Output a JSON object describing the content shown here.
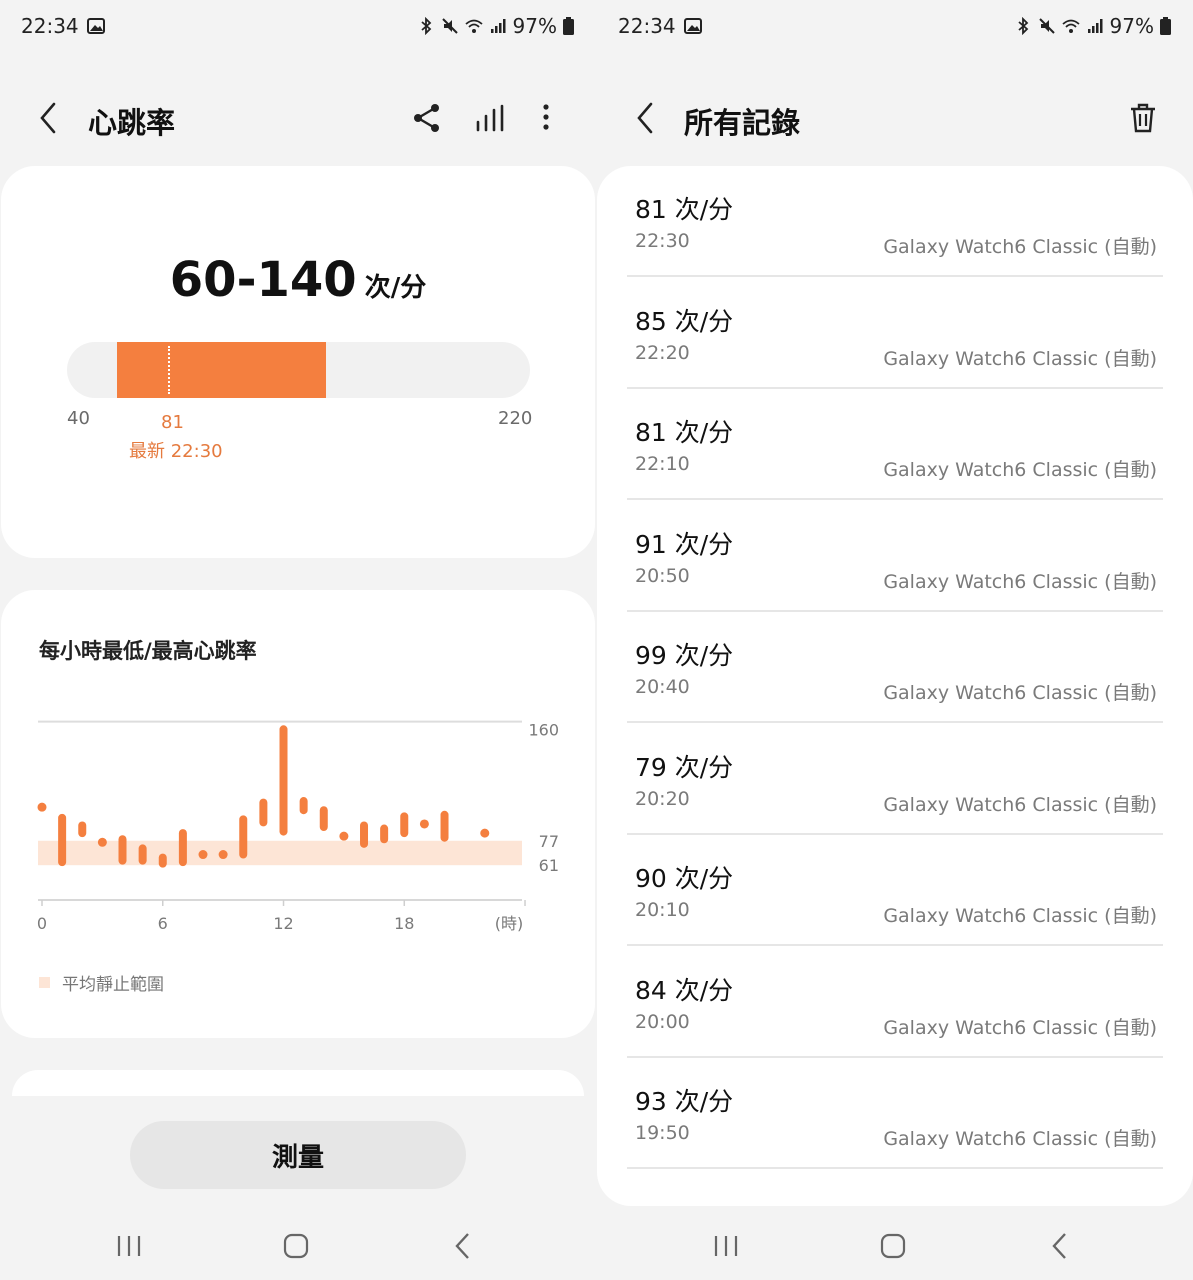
{
  "status": {
    "time": "22:34",
    "battery": "97%"
  },
  "left": {
    "header": {
      "title": "心跳率"
    },
    "range": {
      "value": "60-140",
      "unit": "次/分",
      "min_label": "40",
      "max_label": "220",
      "scale_min": 40,
      "scale_max": 220,
      "range_low": 60,
      "range_high": 140,
      "latest_value": 81,
      "latest_value_label": "81",
      "latest_text": "最新 22:30"
    },
    "chart": {
      "title": "每小時最低/最高心跳率",
      "legend": "平均靜止範圍"
    },
    "measure_label": "測量"
  },
  "chart_data": {
    "type": "bar",
    "title": "每小時最低/最高心跳率",
    "x_ticks": [
      "0",
      "6",
      "12",
      "18",
      "(時)"
    ],
    "y_ticks": [
      "160",
      "77",
      "61"
    ],
    "ylim": [
      50,
      160
    ],
    "resting_range": [
      61,
      77
    ],
    "series": [
      {
        "values": [
          [
            0,
            99,
            99
          ],
          [
            1,
            63,
            92
          ],
          [
            2,
            82,
            87
          ],
          [
            3,
            76,
            76
          ],
          [
            4,
            64,
            78
          ],
          [
            5,
            64,
            72
          ],
          [
            6,
            62,
            66
          ],
          [
            7,
            63,
            82
          ],
          [
            8,
            68,
            68
          ],
          [
            9,
            68,
            68
          ],
          [
            10,
            68,
            91
          ],
          [
            11,
            89,
            102
          ],
          [
            12,
            83,
            150
          ],
          [
            13,
            97,
            103
          ],
          [
            14,
            86,
            97
          ],
          [
            15,
            80,
            80
          ],
          [
            16,
            75,
            87
          ],
          [
            17,
            78,
            85
          ],
          [
            18,
            82,
            93
          ],
          [
            19,
            88,
            88
          ],
          [
            20,
            79,
            94
          ],
          [
            22,
            82,
            82
          ]
        ]
      }
    ]
  },
  "right": {
    "header": {
      "title": "所有記錄"
    },
    "records": [
      {
        "value": "81 次/分",
        "time": "22:30",
        "source": "Galaxy Watch6 Classic (自動)"
      },
      {
        "value": "85 次/分",
        "time": "22:20",
        "source": "Galaxy Watch6 Classic (自動)"
      },
      {
        "value": "81 次/分",
        "time": "22:10",
        "source": "Galaxy Watch6 Classic (自動)"
      },
      {
        "value": "91 次/分",
        "time": "20:50",
        "source": "Galaxy Watch6 Classic (自動)"
      },
      {
        "value": "99 次/分",
        "time": "20:40",
        "source": "Galaxy Watch6 Classic (自動)"
      },
      {
        "value": "79 次/分",
        "time": "20:20",
        "source": "Galaxy Watch6 Classic (自動)"
      },
      {
        "value": "90 次/分",
        "time": "20:10",
        "source": "Galaxy Watch6 Classic (自動)"
      },
      {
        "value": "84 次/分",
        "time": "20:00",
        "source": "Galaxy Watch6 Classic (自動)"
      },
      {
        "value": "93 次/分",
        "time": "19:50",
        "source": "Galaxy Watch6 Classic (自動)"
      }
    ]
  },
  "colors": {
    "accent": "#f47f3f",
    "resting_band": "#fde5d6"
  }
}
